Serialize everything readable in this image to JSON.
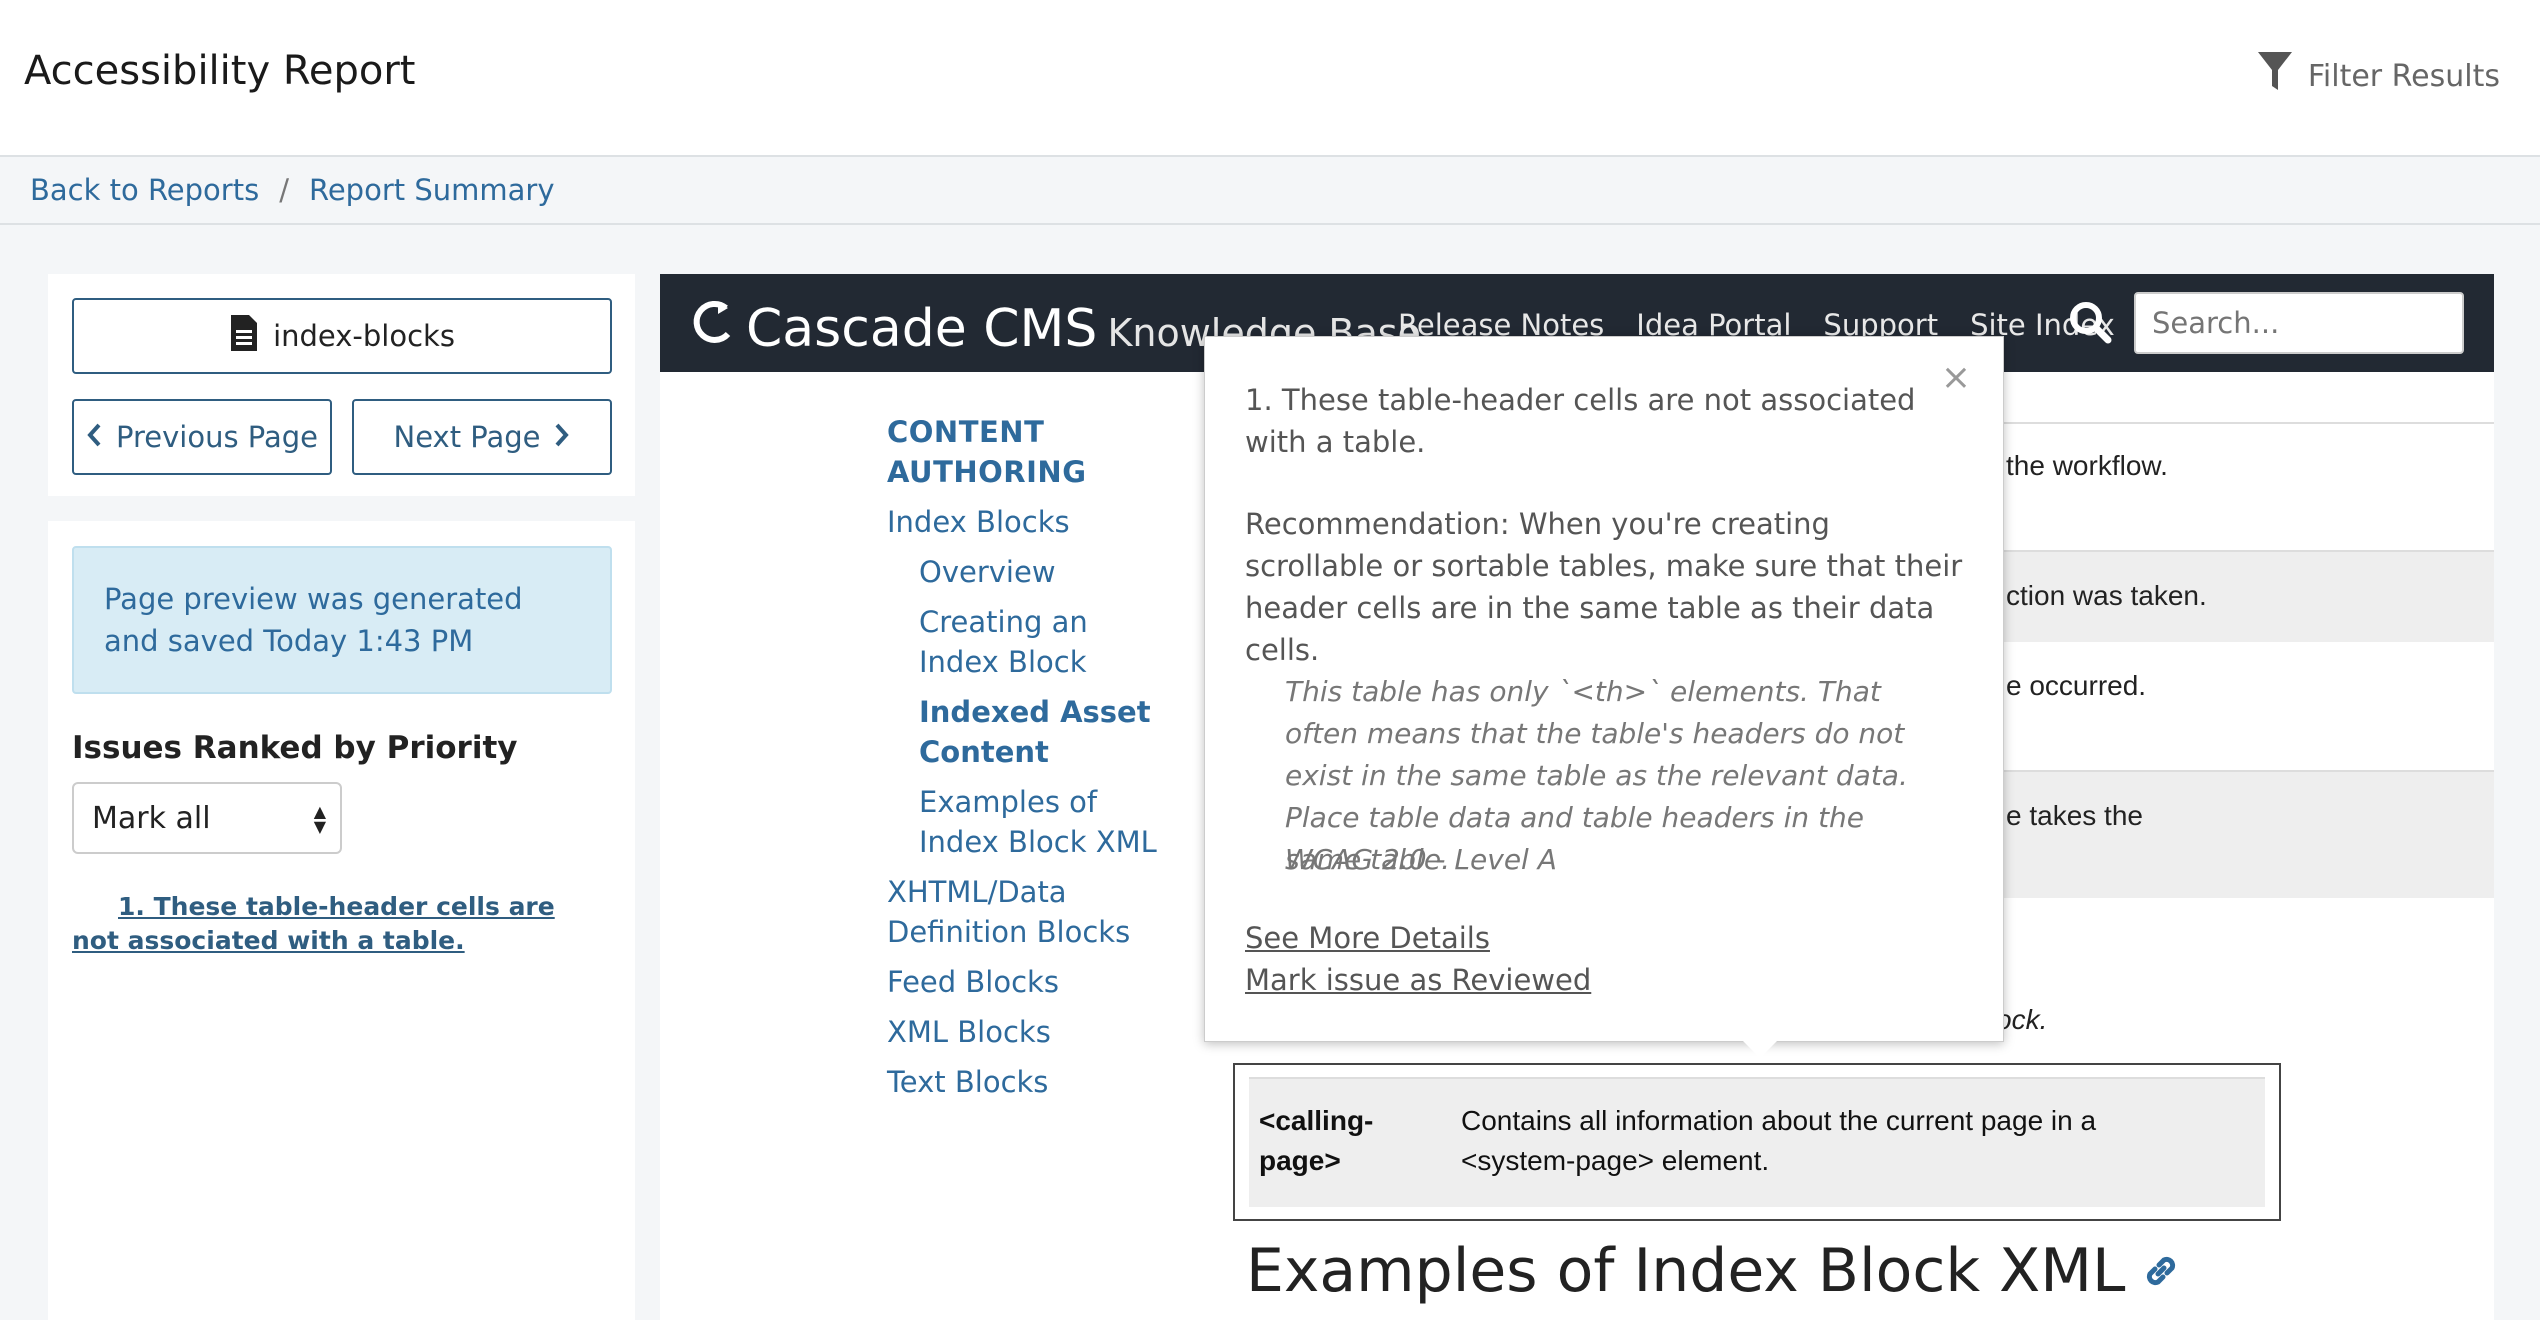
{
  "app": {
    "title": "Accessibility Report",
    "filter_label": "Filter Results"
  },
  "breadcrumb": {
    "back": "Back to Reports",
    "separator": "/",
    "current": "Report Summary"
  },
  "sidebar": {
    "page_button": "index-blocks",
    "prev_label": "Previous Page",
    "next_label": "Next Page",
    "info": "Page preview was generated and saved Today 1:43 PM",
    "issues_heading": "Issues Ranked by Priority",
    "select_value": "Mark all",
    "issue_link": "1. These table-header cells are not associated with a table."
  },
  "preview": {
    "brand": "Cascade CMS",
    "kb": "Knowledge Base",
    "nav_links": [
      "Release Notes",
      "Idea Portal",
      "Support",
      "Site Index"
    ],
    "search_placeholder": "Search...",
    "side_nav": {
      "section": "CONTENT AUTHORING",
      "index_blocks": "Index Blocks",
      "overview": "Overview",
      "creating": "Creating an Index Block",
      "indexed_asset": "Indexed Asset Content",
      "examples": "Examples of Index Block XML",
      "xhtml": "XHTML/Data Definition Blocks",
      "feed": "Feed Blocks",
      "xml": "XML Blocks",
      "text": "Text Blocks"
    },
    "bg_fragments": [
      "the workflow.",
      "ction was taken.",
      "e occurred.",
      "e takes the",
      "ock."
    ],
    "table": {
      "header": "<calling-page>",
      "cell": "Contains all information about the current page in a <system-page> element."
    },
    "heading": "Examples of Index Block XML"
  },
  "popover": {
    "close": "×",
    "title": "1. These table-header cells are not associated with a table.",
    "recommendation": "Recommendation: When you're creating scrollable or sortable tables, make sure that their header cells are in the same table as their data cells.",
    "detail": "This table has only `<th>` elements. That often means that the table's headers do not exist in the same table as the relevant data. Place table data and table headers in the same table.",
    "wcag": "WCAG 2.0 - Level A",
    "see_more": "See More Details",
    "mark_reviewed": "Mark issue as Reviewed"
  }
}
